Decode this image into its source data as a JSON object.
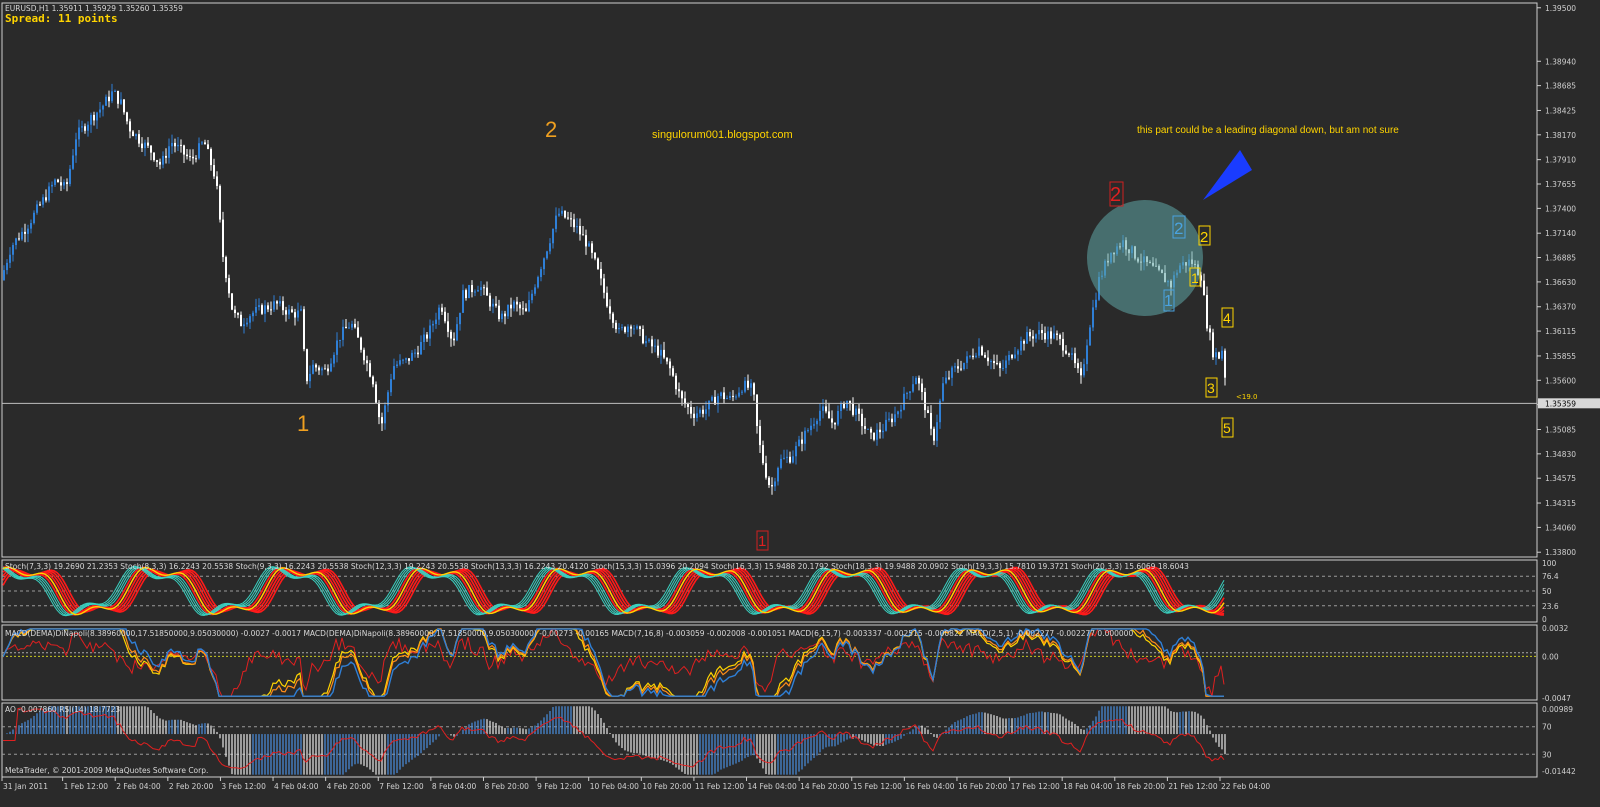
{
  "header": {
    "symbol_line": "EURUSD,H1  1.35911 1.35929 1.35260 1.35359",
    "spread": "Spread: 11 points"
  },
  "annotations": {
    "blog": "singulorum001.blogspot.com",
    "note": "this part could be a leading diagonal down, but am not sure",
    "wave_1_orange": "1",
    "wave_2_orange": "2",
    "red_1": "1",
    "red_2": "2",
    "blue_1": "1",
    "blue_2": "2",
    "yellow_1": "1",
    "yellow_2": "2",
    "yellow_3": "3",
    "yellow_4": "4",
    "yellow_5": "5",
    "price_tag": "<19.0"
  },
  "indicators": {
    "stoch_header": "Stoch(7,3,3) 19.2690 21.2353  Stoch(8,3,3) 16.2243 20.5538  Stoch(9,3,3) 16.2243 20.5538  Stoch(12,3,3) 19.2243 20.5538  Stoch(13,3,3) 16.2243 20.4120  Stoch(15,3,3) 15.0396 20.2094  Stoch(16,3,3) 15.9488 20.1792  Stoch(18,3,3) 19.9488 20.0902  Stoch(19,3,3) 15.7810 19.3721  Stoch(20,3,3) 15.6069 18.6043",
    "stoch_levels": [
      "100",
      "76.4",
      "50",
      "23.6",
      "0"
    ],
    "macd_header": "MACD(DEMA)DiNapoli(8.38960000,17.51850000,9.05030000) -0.0027 -0.0017  MACD(DEMA)DiNapoli(8.38960000,17.51850000,9.05030000) -0.00273 -0.00165  MACD(7,16,8) -0.003059 -0.002008 -0.001051  MACD(6,15,7) -0.003337 -0.002515 -0.000822  MACD(2,5,1) -0.002277 -0.002277 0.000000",
    "macd_levels": [
      "0.0032",
      "0.00",
      "-0.0047"
    ],
    "ao_rsi_header": "AO -0.007860  RSI(14) 18.7723",
    "ao_levels": [
      "0.00989",
      "70",
      "30",
      "-0.01442"
    ]
  },
  "footer": {
    "copyright": "MetaTrader, © 2001-2009 MetaQuotes Software Corp."
  },
  "colors": {
    "background": "#2a2a2a",
    "bull": "#2f7fd6",
    "bear": "#ffffff",
    "annotation": "#ffd400",
    "wave_orange": "#f0a020",
    "stoch_red": "#ff1a1a",
    "stoch_cyan": "#3ad0c0",
    "stoch_yellow": "#ffd400"
  },
  "chart_data": {
    "type": "candlestick",
    "symbol": "EURUSD",
    "timeframe": "H1",
    "current_price": 1.35359,
    "ylim": [
      1.3375,
      1.3955
    ],
    "y_ticks": [
      "1.39500",
      "1.38940",
      "1.38685",
      "1.38425",
      "1.38170",
      "1.37910",
      "1.37655",
      "1.37400",
      "1.37140",
      "1.36885",
      "1.36630",
      "1.36370",
      "1.36115",
      "1.35855",
      "1.35600",
      "1.35345",
      "1.35085",
      "1.34830",
      "1.34575",
      "1.34315",
      "1.34060",
      "1.33800"
    ],
    "x_ticks": [
      "31 Jan 2011",
      "1 Feb 12:00",
      "2 Feb 04:00",
      "2 Feb 20:00",
      "3 Feb 12:00",
      "4 Feb 04:00",
      "4 Feb 20:00",
      "7 Feb 12:00",
      "8 Feb 04:00",
      "8 Feb 20:00",
      "9 Feb 12:00",
      "10 Feb 04:00",
      "10 Feb 20:00",
      "11 Feb 12:00",
      "14 Feb 04:00",
      "14 Feb 20:00",
      "15 Feb 12:00",
      "16 Feb 04:00",
      "16 Feb 20:00",
      "17 Feb 12:00",
      "18 Feb 04:00",
      "18 Feb 20:00",
      "21 Feb 12:00",
      "22 Feb 04:00"
    ],
    "path_points": [
      [
        0,
        1.3665
      ],
      [
        10,
        1.37
      ],
      [
        25,
        1.372
      ],
      [
        40,
        1.3745
      ],
      [
        55,
        1.377
      ],
      [
        65,
        1.376
      ],
      [
        75,
        1.3815
      ],
      [
        90,
        1.3835
      ],
      [
        100,
        1.3845
      ],
      [
        112,
        1.3862
      ],
      [
        120,
        1.385
      ],
      [
        128,
        1.3825
      ],
      [
        140,
        1.381
      ],
      [
        150,
        1.38
      ],
      [
        160,
        1.3785
      ],
      [
        170,
        1.381
      ],
      [
        180,
        1.38
      ],
      [
        190,
        1.379
      ],
      [
        203,
        1.381
      ],
      [
        215,
        1.377
      ],
      [
        222,
        1.369
      ],
      [
        232,
        1.363
      ],
      [
        240,
        1.362
      ],
      [
        250,
        1.363
      ],
      [
        262,
        1.3635
      ],
      [
        275,
        1.364
      ],
      [
        290,
        1.363
      ],
      [
        300,
        1.363
      ],
      [
        305,
        1.356
      ],
      [
        312,
        1.3575
      ],
      [
        325,
        1.357
      ],
      [
        338,
        1.3605
      ],
      [
        350,
        1.362
      ],
      [
        360,
        1.3595
      ],
      [
        372,
        1.356
      ],
      [
        380,
        1.351
      ],
      [
        392,
        1.3575
      ],
      [
        405,
        1.358
      ],
      [
        415,
        1.359
      ],
      [
        428,
        1.361
      ],
      [
        440,
        1.364
      ],
      [
        452,
        1.36
      ],
      [
        462,
        1.365
      ],
      [
        478,
        1.366
      ],
      [
        490,
        1.364
      ],
      [
        500,
        1.3625
      ],
      [
        512,
        1.364
      ],
      [
        525,
        1.363
      ],
      [
        535,
        1.3665
      ],
      [
        548,
        1.3705
      ],
      [
        557,
        1.3735
      ],
      [
        565,
        1.373
      ],
      [
        575,
        1.372
      ],
      [
        585,
        1.3705
      ],
      [
        595,
        1.368
      ],
      [
        605,
        1.3645
      ],
      [
        618,
        1.361
      ],
      [
        630,
        1.362
      ],
      [
        645,
        1.36
      ],
      [
        658,
        1.359
      ],
      [
        670,
        1.357
      ],
      [
        680,
        1.354
      ],
      [
        692,
        1.3525
      ],
      [
        705,
        1.353
      ],
      [
        718,
        1.3545
      ],
      [
        730,
        1.354
      ],
      [
        742,
        1.3555
      ],
      [
        752,
        1.355
      ],
      [
        757,
        1.35
      ],
      [
        763,
        1.347
      ],
      [
        770,
        1.3445
      ],
      [
        778,
        1.3475
      ],
      [
        790,
        1.348
      ],
      [
        805,
        1.3505
      ],
      [
        820,
        1.353
      ],
      [
        832,
        1.3515
      ],
      [
        845,
        1.354
      ],
      [
        858,
        1.352
      ],
      [
        870,
        1.35
      ],
      [
        882,
        1.351
      ],
      [
        895,
        1.3525
      ],
      [
        905,
        1.3545
      ],
      [
        915,
        1.3565
      ],
      [
        925,
        1.353
      ],
      [
        932,
        1.3495
      ],
      [
        942,
        1.3555
      ],
      [
        952,
        1.357
      ],
      [
        965,
        1.358
      ],
      [
        978,
        1.3595
      ],
      [
        990,
        1.358
      ],
      [
        1000,
        1.357
      ],
      [
        1012,
        1.359
      ],
      [
        1025,
        1.3605
      ],
      [
        1040,
        1.361
      ],
      [
        1055,
        1.3605
      ],
      [
        1068,
        1.359
      ],
      [
        1080,
        1.356
      ],
      [
        1088,
        1.3615
      ],
      [
        1098,
        1.3665
      ],
      [
        1110,
        1.3695
      ],
      [
        1122,
        1.3705
      ],
      [
        1135,
        1.369
      ],
      [
        1148,
        1.368
      ],
      [
        1160,
        1.367
      ],
      [
        1170,
        1.366
      ],
      [
        1178,
        1.368
      ],
      [
        1190,
        1.3685
      ],
      [
        1200,
        1.367
      ],
      [
        1206,
        1.362
      ],
      [
        1212,
        1.359
      ],
      [
        1218,
        1.3585
      ],
      [
        1222,
        1.3595
      ],
      [
        1226,
        1.3536
      ]
    ]
  }
}
